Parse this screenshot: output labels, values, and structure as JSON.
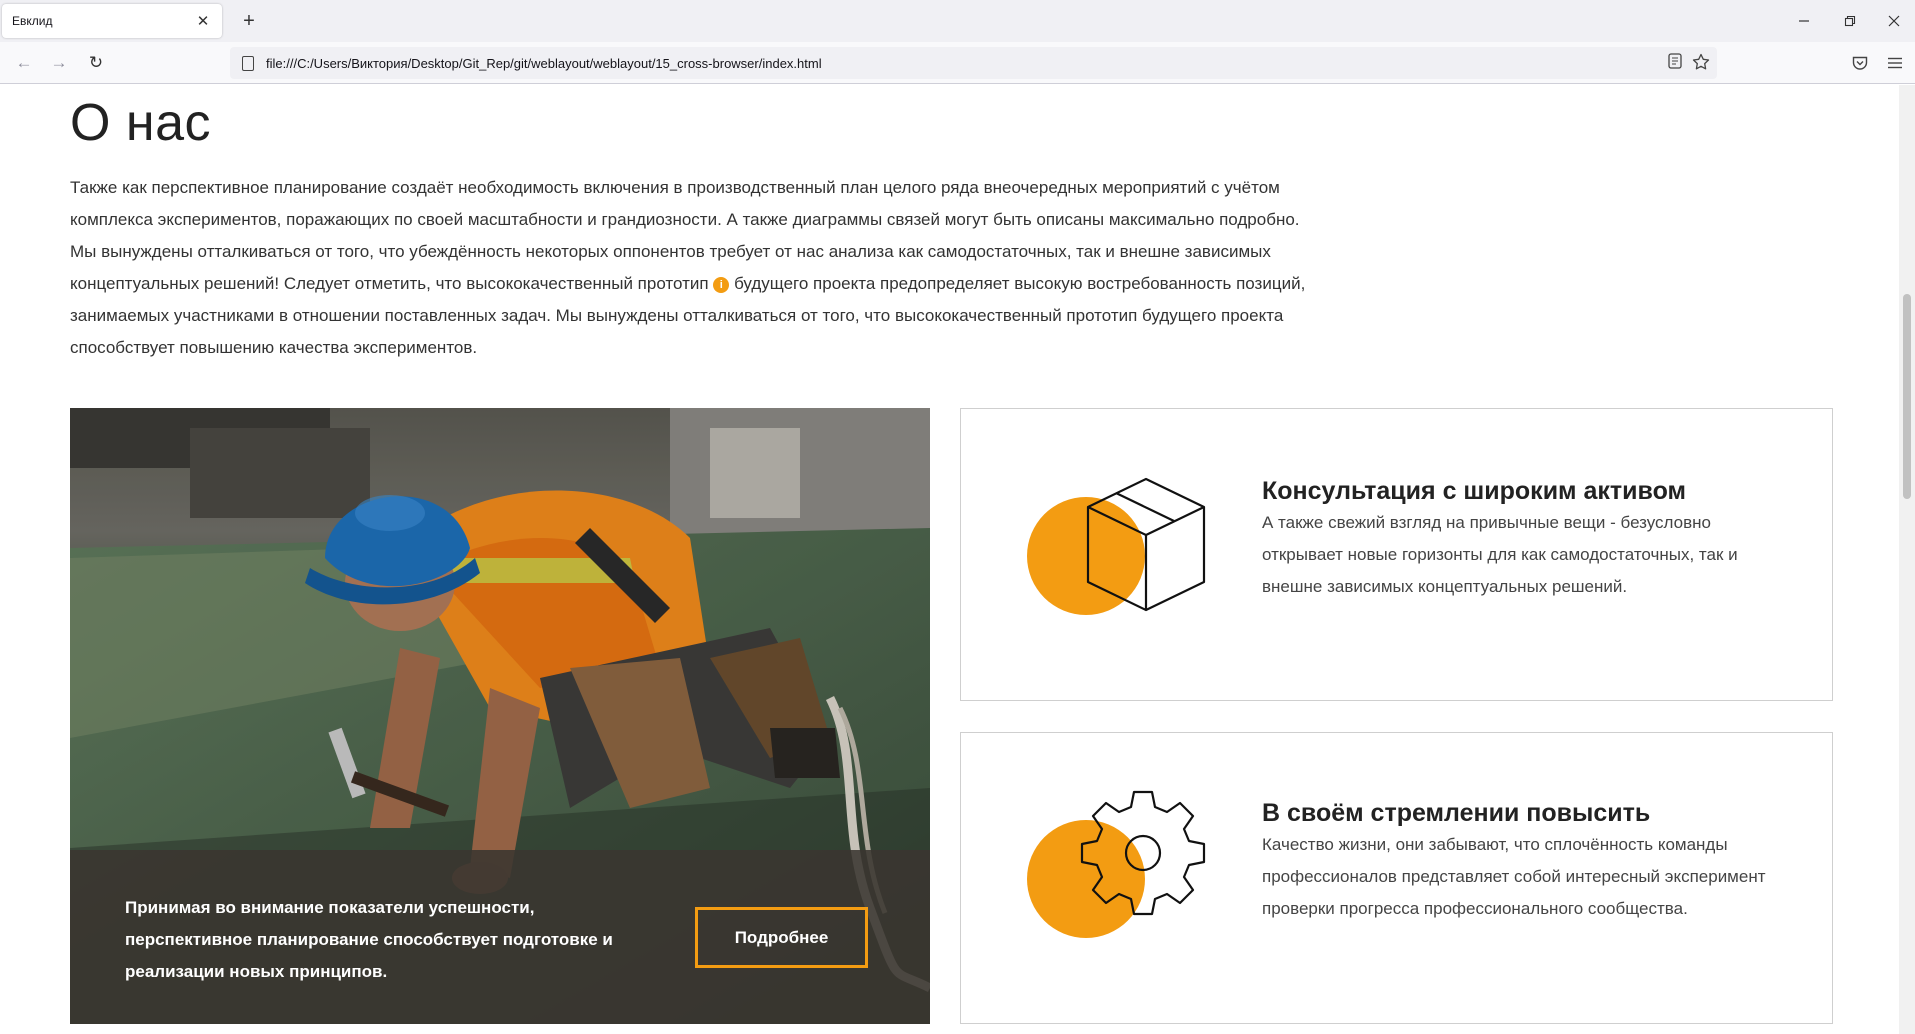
{
  "browser": {
    "tab_title": "Евклид",
    "tab_close": "✕",
    "new_tab": "+",
    "url": "file:///C:/Users/Виктория/Desktop/Git_Rep/git/weblayout/weblayout/15_cross-browser/index.html",
    "window_controls": {
      "minimize": "—",
      "restore": "❐",
      "close": "✕"
    },
    "nav": {
      "back": "←",
      "forward": "→",
      "reload": "↻"
    }
  },
  "about": {
    "title": "О нас",
    "text_part1": "Также как перспективное планирование создаёт необходимость включения в производственный план целого ряда внеочередных мероприятий с учётом комплекса экспериментов, поражающих по своей масштабности и грандиозности. А также диаграммы связей могут быть описаны максимально подробно. Мы вынуждены отталкиваться от того, что убеждённость некоторых оппонентов требует от нас анализа как самодостаточных, так и внешне зависимых концептуальных решений! Следует отметить, что высококачественный прототип",
    "info_icon_glyph": "i",
    "text_part2": "будущего проекта предопределяет высокую востребованность позиций, занимаемых участниками в отношении поставленных задач. Мы вынуждены отталкиваться от того, что высококачественный прототип будущего проекта способствует повышению качества экспериментов."
  },
  "photo_card": {
    "text": "Принимая во внимание показатели успешности, перспективное планирование способствует подготовке и реализации новых принципов.",
    "button_label": "Подробнее"
  },
  "features": [
    {
      "title": "Консультация с широким активом",
      "text": "А также свежий взгляд на привычные вещи - безусловно открывает новые горизонты для как самодостаточных, так и внешне зависимых концептуальных решений.",
      "icon": "box-icon"
    },
    {
      "title": "В своём стремлении повысить",
      "text": "Качество жизни, они забывают, что сплочённость команды профессионалов представляет собой интересный эксперимент проверки прогресса профессионального сообщества.",
      "icon": "gear-icon"
    }
  ],
  "colors": {
    "accent": "#f39c12",
    "text": "#333333",
    "border": "#cfcfcf"
  }
}
